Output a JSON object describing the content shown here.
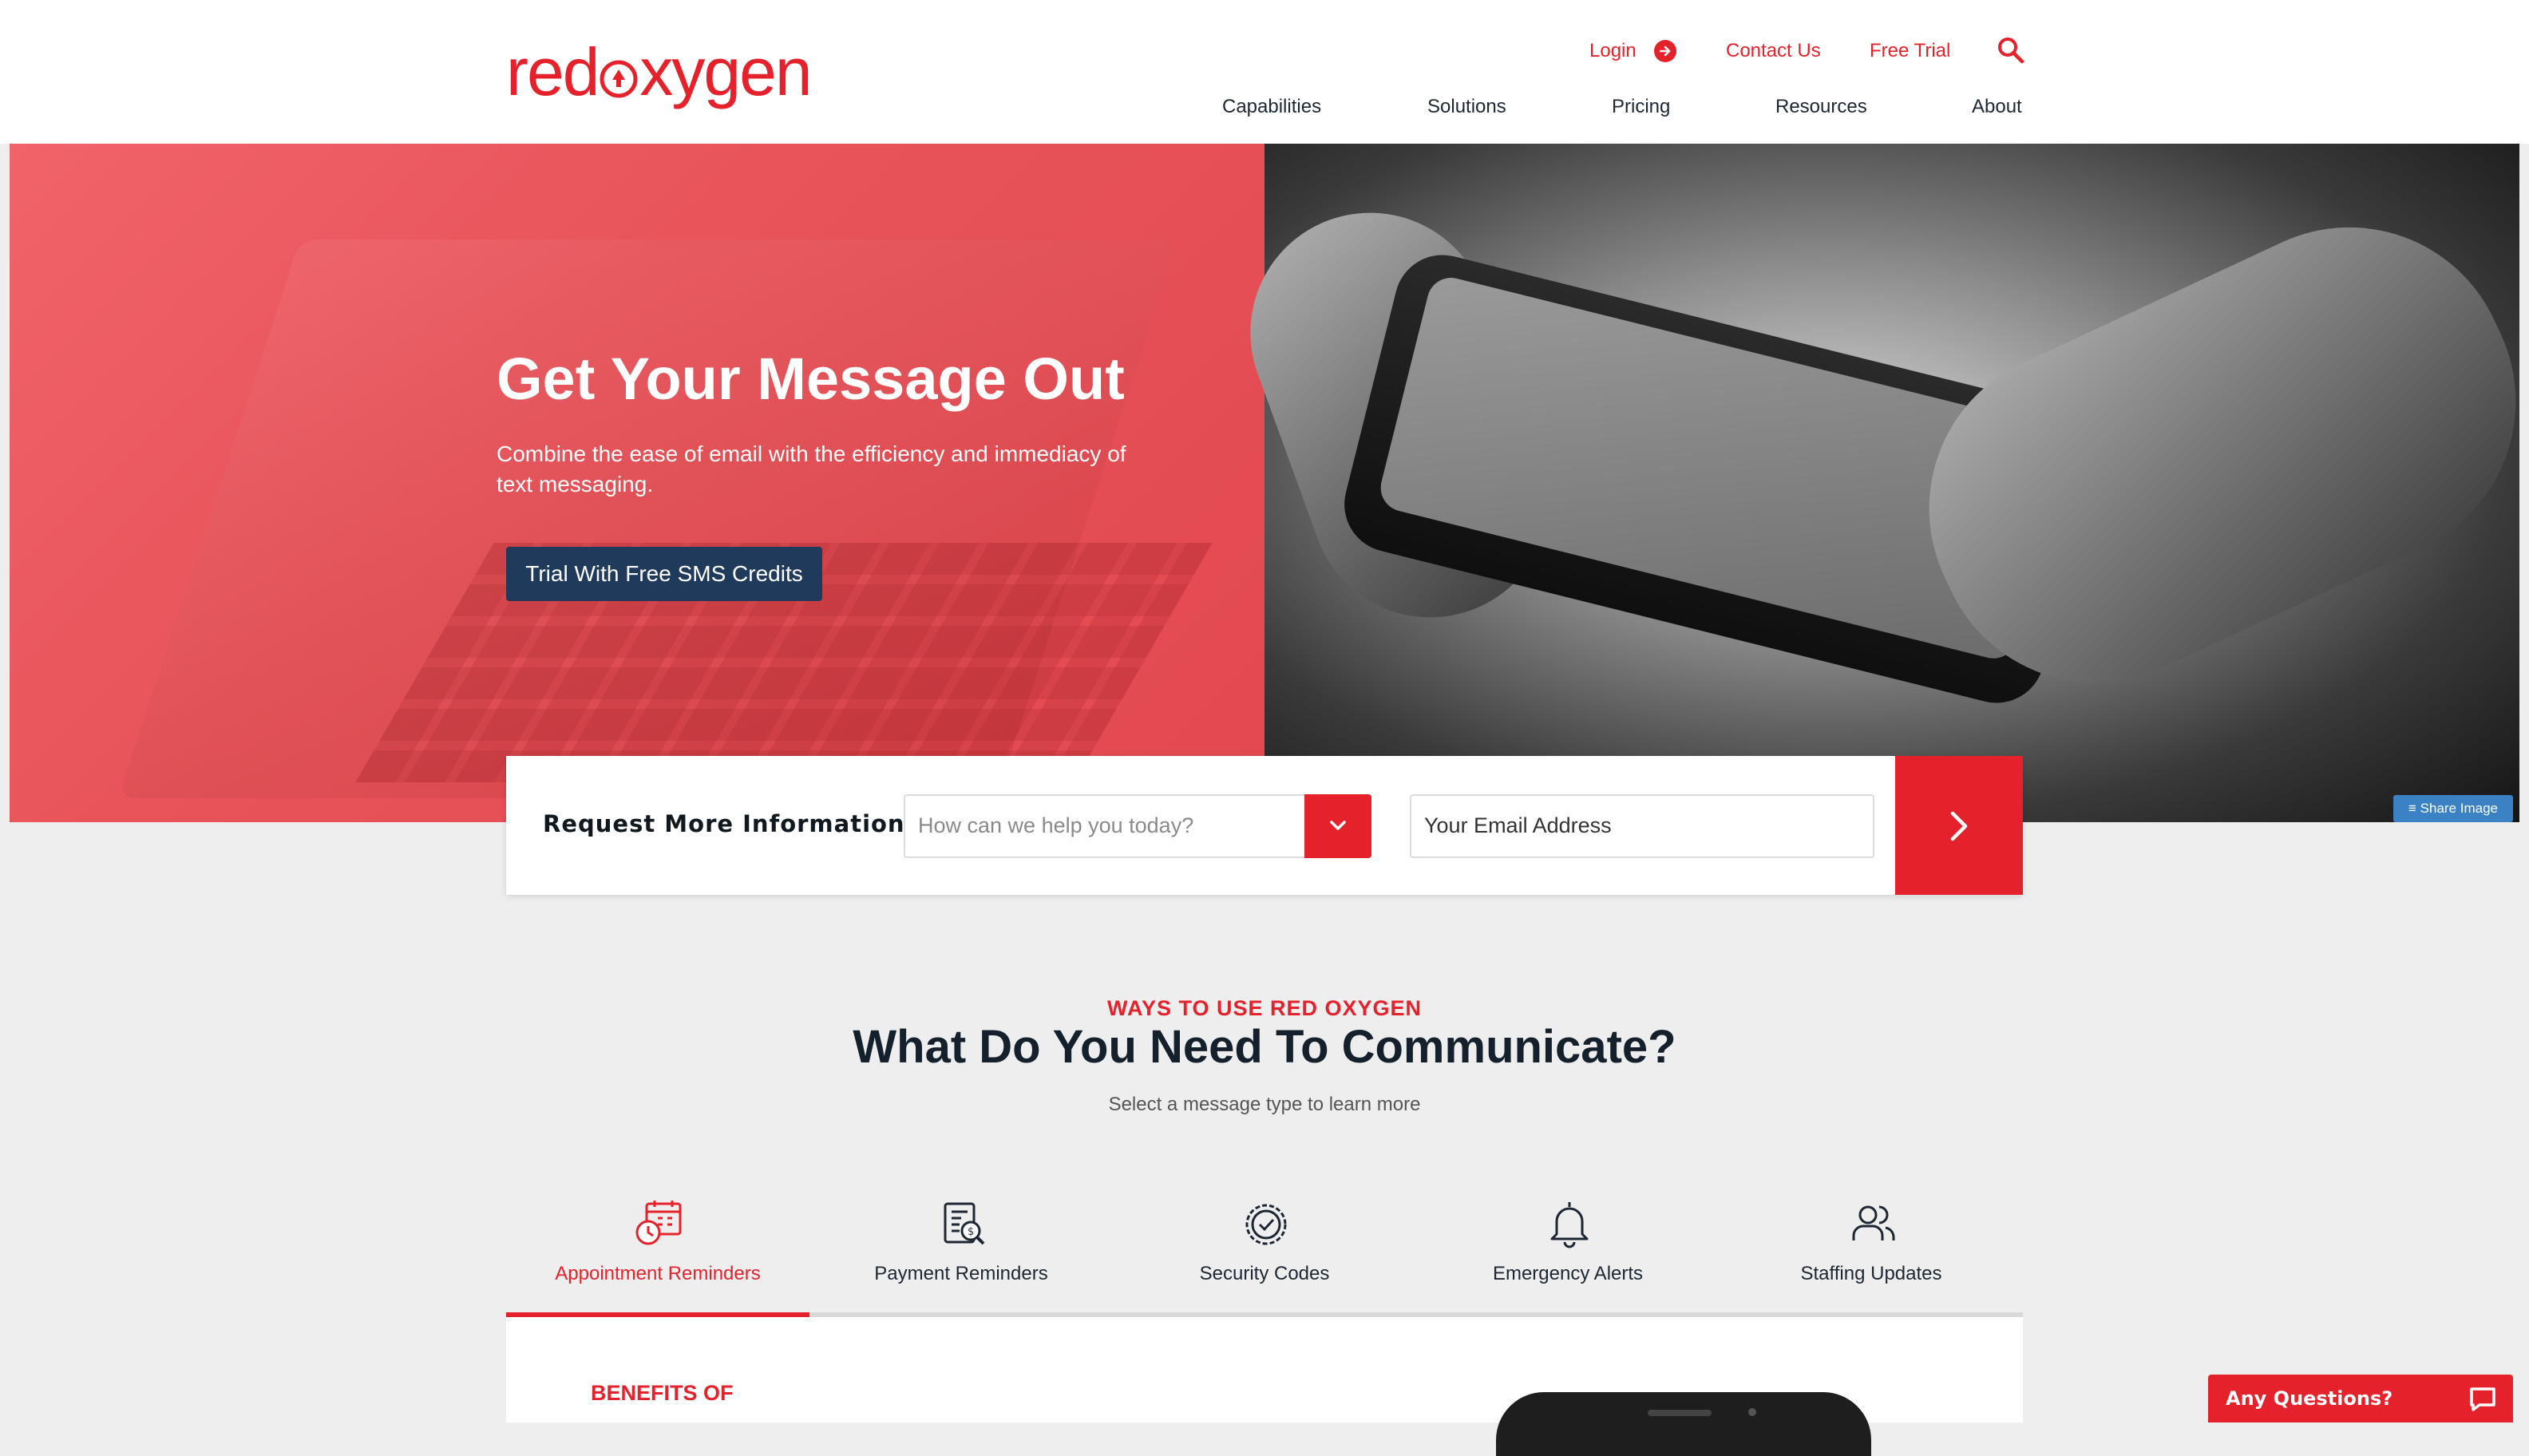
{
  "brand": {
    "logo_text_a": "red",
    "logo_text_b": "xygen",
    "accent": "#e5222b",
    "navy": "#1f3a5a"
  },
  "utility_nav": {
    "login": "Login",
    "contact": "Contact Us",
    "free_trial": "Free Trial",
    "search_icon": "search-icon"
  },
  "main_nav": [
    "Capabilities",
    "Solutions",
    "Pricing",
    "Resources",
    "About"
  ],
  "hero": {
    "title": "Get Your Message Out",
    "subtitle": "Combine the ease of email with the efficiency and immediacy of text messaging.",
    "cta": "Trial With Free SMS Credits",
    "share": "Share Image"
  },
  "request_form": {
    "title": "Request More Information",
    "select_placeholder": "How can we help you today?",
    "email_placeholder": "Your Email Address"
  },
  "section": {
    "eyebrow": "WAYS TO USE RED OXYGEN",
    "title": "What Do You Need To Communicate?",
    "subtitle": "Select a message type to learn more"
  },
  "tabs": [
    {
      "label": "Appointment Reminders",
      "icon": "calendar-clock-icon",
      "active": true
    },
    {
      "label": "Payment Reminders",
      "icon": "invoice-search-icon",
      "active": false
    },
    {
      "label": "Security Codes",
      "icon": "clock-check-icon",
      "active": false
    },
    {
      "label": "Emergency Alerts",
      "icon": "bell-icon",
      "active": false
    },
    {
      "label": "Staffing Updates",
      "icon": "users-icon",
      "active": false
    }
  ],
  "panel": {
    "benefits_heading": "BENEFITS OF"
  },
  "chat": {
    "label": "Any Questions?"
  }
}
